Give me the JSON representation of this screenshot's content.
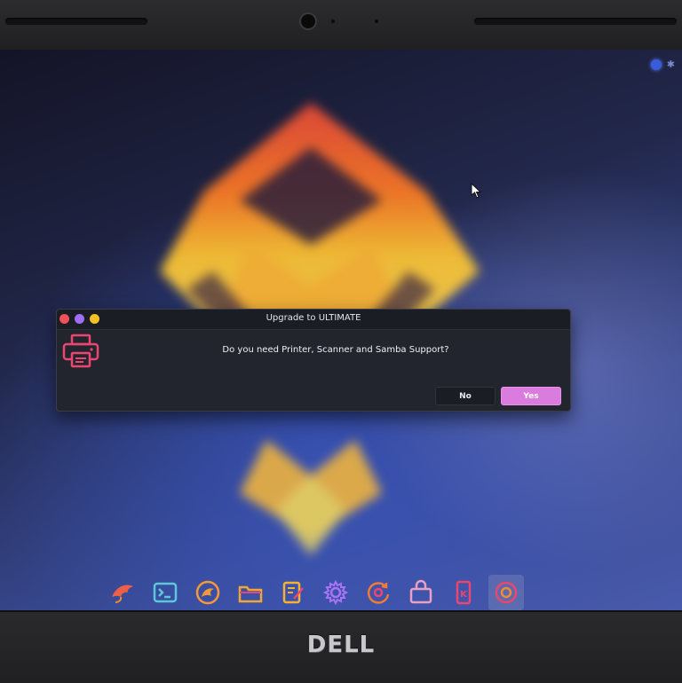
{
  "hardware": {
    "brand": "DELL"
  },
  "dialog": {
    "title": "Upgrade to ULTIMATE",
    "message": "Do you need Printer, Scanner and Samba Support?",
    "no_label": "No",
    "yes_label": "Yes",
    "icon": "printer-icon",
    "buttons_accent": "#d67ddb",
    "window_controls": [
      "close",
      "minimize",
      "maximize"
    ]
  },
  "tray": {
    "icons": [
      "network-icon",
      "bluetooth-icon"
    ]
  },
  "dock": {
    "items": [
      {
        "name": "garuda-eagle-icon"
      },
      {
        "name": "terminal-icon"
      },
      {
        "name": "browser-icon"
      },
      {
        "name": "folder-icon"
      },
      {
        "name": "text-editor-icon"
      },
      {
        "name": "settings-gear-icon"
      },
      {
        "name": "update-icon"
      },
      {
        "name": "software-store-icon"
      },
      {
        "name": "kde-connect-icon"
      },
      {
        "name": "garuda-assistant-icon",
        "active": true
      }
    ]
  },
  "colors": {
    "accent_pink": "#e5486f",
    "accent_orange": "#f08a3a",
    "desktop_blue": "#3a4a90"
  }
}
